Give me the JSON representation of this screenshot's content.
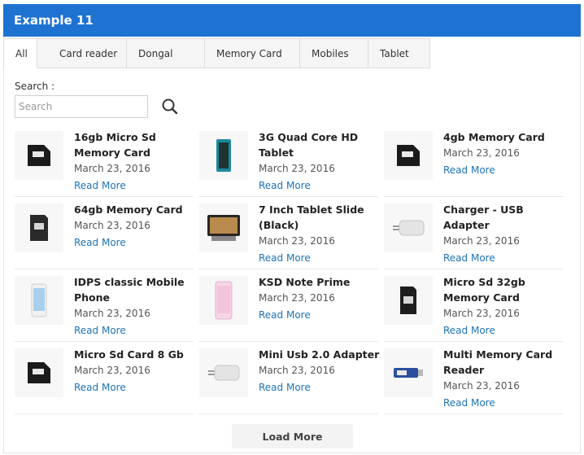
{
  "header": {
    "title": "Example 11"
  },
  "tabs": [
    {
      "label": "All"
    },
    {
      "label": "Card reader"
    },
    {
      "label": "Dongal"
    },
    {
      "label": "Memory Card"
    },
    {
      "label": "Mobiles"
    },
    {
      "label": "Tablet"
    }
  ],
  "search": {
    "label": "Search :",
    "placeholder": "Search"
  },
  "products": [
    {
      "title": "16gb Micro Sd Memory Card",
      "date": "March 23, 2016",
      "link": "Read More",
      "icon": "memory-card-icon"
    },
    {
      "title": "3G Quad Core HD Tablet",
      "date": "March 23, 2016",
      "link": "Read More",
      "icon": "tablet-icon"
    },
    {
      "title": "4gb Memory Card",
      "date": "March 23, 2016",
      "link": "Read More",
      "icon": "memory-card-icon"
    },
    {
      "title": "64gb Memory Card",
      "date": "March 23, 2016",
      "link": "Read More",
      "icon": "memory-card-icon"
    },
    {
      "title": "7 Inch Tablet Slide (Black)",
      "date": "March 23, 2016",
      "link": "Read More",
      "icon": "tablet-icon"
    },
    {
      "title": "Charger - USB Adapter",
      "date": "March 23, 2016",
      "link": "Read More",
      "icon": "usb-adapter-icon"
    },
    {
      "title": "IDPS classic Mobile Phone",
      "date": "March 23, 2016",
      "link": "Read More",
      "icon": "phone-icon"
    },
    {
      "title": "KSD Note Prime",
      "date": "March 23, 2016",
      "link": "Read More",
      "icon": "phone-icon"
    },
    {
      "title": "Micro Sd 32gb Memory Card",
      "date": "March 23, 2016",
      "link": "Read More",
      "icon": "memory-card-icon"
    },
    {
      "title": "Micro Sd Card 8 Gb",
      "date": "March 23, 2016",
      "link": "Read More",
      "icon": "memory-card-icon"
    },
    {
      "title": "Mini Usb 2.0 Adapter",
      "date": "March 23, 2016",
      "link": "Read More",
      "icon": "usb-adapter-icon"
    },
    {
      "title": "Multi Memory Card Reader",
      "date": "March 23, 2016",
      "link": "Read More",
      "icon": "card-reader-icon"
    }
  ],
  "load_more": {
    "label": "Load More"
  }
}
